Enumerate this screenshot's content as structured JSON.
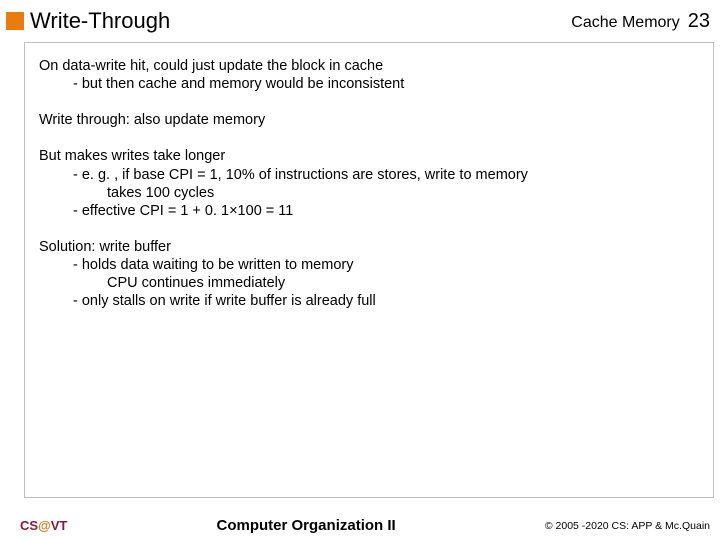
{
  "header": {
    "title": "Write-Through",
    "topic": "Cache Memory",
    "page": "23"
  },
  "body": {
    "p1": "On data-write hit, could just update the block in cache",
    "p1a": "-  but then cache and memory would be inconsistent",
    "p2": "Write through: also update memory",
    "p3": "But makes writes take longer",
    "p3a": "-  e. g. , if base CPI = 1, 10% of instructions are stores, write to memory",
    "p3a2": "takes 100 cycles",
    "p3b": "-  effective CPI = 1 + 0. 1×100 = 11",
    "p4": "Solution: write buffer",
    "p4a": "-  holds data waiting to be written to memory",
    "p4a2": "CPU continues immediately",
    "p4b": "-  only stalls on write if write buffer is already full"
  },
  "footer": {
    "left_cs": "CS",
    "left_at": "@",
    "left_vt": "VT",
    "center": "Computer Organization II",
    "right": "© 2005 -2020 CS: APP & Mc.Quain"
  }
}
